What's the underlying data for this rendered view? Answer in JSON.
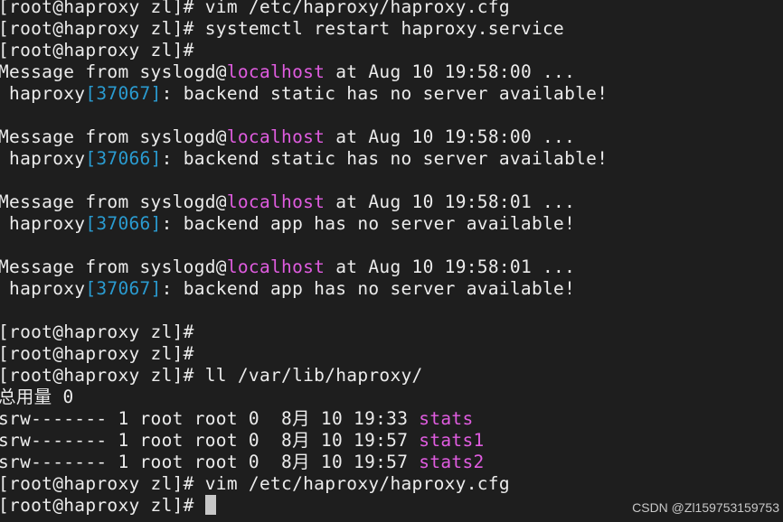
{
  "lines": [
    [
      {
        "t": "[root@haproxy zl]# vim /etc/haproxy/haproxy.cfg"
      }
    ],
    [
      {
        "t": "[root@haproxy zl]# systemctl restart haproxy.service"
      }
    ],
    [
      {
        "t": "[root@haproxy zl]#"
      }
    ],
    [
      {
        "t": "Message from syslogd@"
      },
      {
        "t": "localhost",
        "c": "host"
      },
      {
        "t": " at Aug 10 19:58:00 ..."
      }
    ],
    [
      {
        "t": " haproxy"
      },
      {
        "t": "[37067]",
        "c": "pid"
      },
      {
        "t": ": backend static has no server available!"
      }
    ],
    [
      {
        "t": ""
      }
    ],
    [
      {
        "t": "Message from syslogd@"
      },
      {
        "t": "localhost",
        "c": "host"
      },
      {
        "t": " at Aug 10 19:58:00 ..."
      }
    ],
    [
      {
        "t": " haproxy"
      },
      {
        "t": "[37066]",
        "c": "pid"
      },
      {
        "t": ": backend static has no server available!"
      }
    ],
    [
      {
        "t": ""
      }
    ],
    [
      {
        "t": "Message from syslogd@"
      },
      {
        "t": "localhost",
        "c": "host"
      },
      {
        "t": " at Aug 10 19:58:01 ..."
      }
    ],
    [
      {
        "t": " haproxy"
      },
      {
        "t": "[37066]",
        "c": "pid"
      },
      {
        "t": ": backend app has no server available!"
      }
    ],
    [
      {
        "t": ""
      }
    ],
    [
      {
        "t": "Message from syslogd@"
      },
      {
        "t": "localhost",
        "c": "host"
      },
      {
        "t": " at Aug 10 19:58:01 ..."
      }
    ],
    [
      {
        "t": " haproxy"
      },
      {
        "t": "[37067]",
        "c": "pid"
      },
      {
        "t": ": backend app has no server available!"
      }
    ],
    [
      {
        "t": ""
      }
    ],
    [
      {
        "t": "[root@haproxy zl]#"
      }
    ],
    [
      {
        "t": "[root@haproxy zl]#"
      }
    ],
    [
      {
        "t": "[root@haproxy zl]# ll /var/lib/haproxy/"
      }
    ],
    [
      {
        "t": "总用量 0"
      }
    ],
    [
      {
        "t": "srw------- 1 root root 0  8月 10 19:33 "
      },
      {
        "t": "stats",
        "c": "file"
      }
    ],
    [
      {
        "t": "srw------- 1 root root 0  8月 10 19:57 "
      },
      {
        "t": "stats1",
        "c": "file"
      }
    ],
    [
      {
        "t": "srw------- 1 root root 0  8月 10 19:57 "
      },
      {
        "t": "stats2",
        "c": "file"
      }
    ],
    [
      {
        "t": "[root@haproxy zl]# vim /etc/haproxy/haproxy.cfg"
      }
    ],
    [
      {
        "t": "[root@haproxy zl]# "
      },
      {
        "t": "",
        "c": "cursor"
      }
    ]
  ],
  "colors": {
    "background": "#1e1e1e",
    "text": "#ececec",
    "host": "#e05ce0",
    "pid": "#2a9bd0",
    "file": "#e05ce0"
  },
  "watermark": "CSDN @Zl159753159753"
}
